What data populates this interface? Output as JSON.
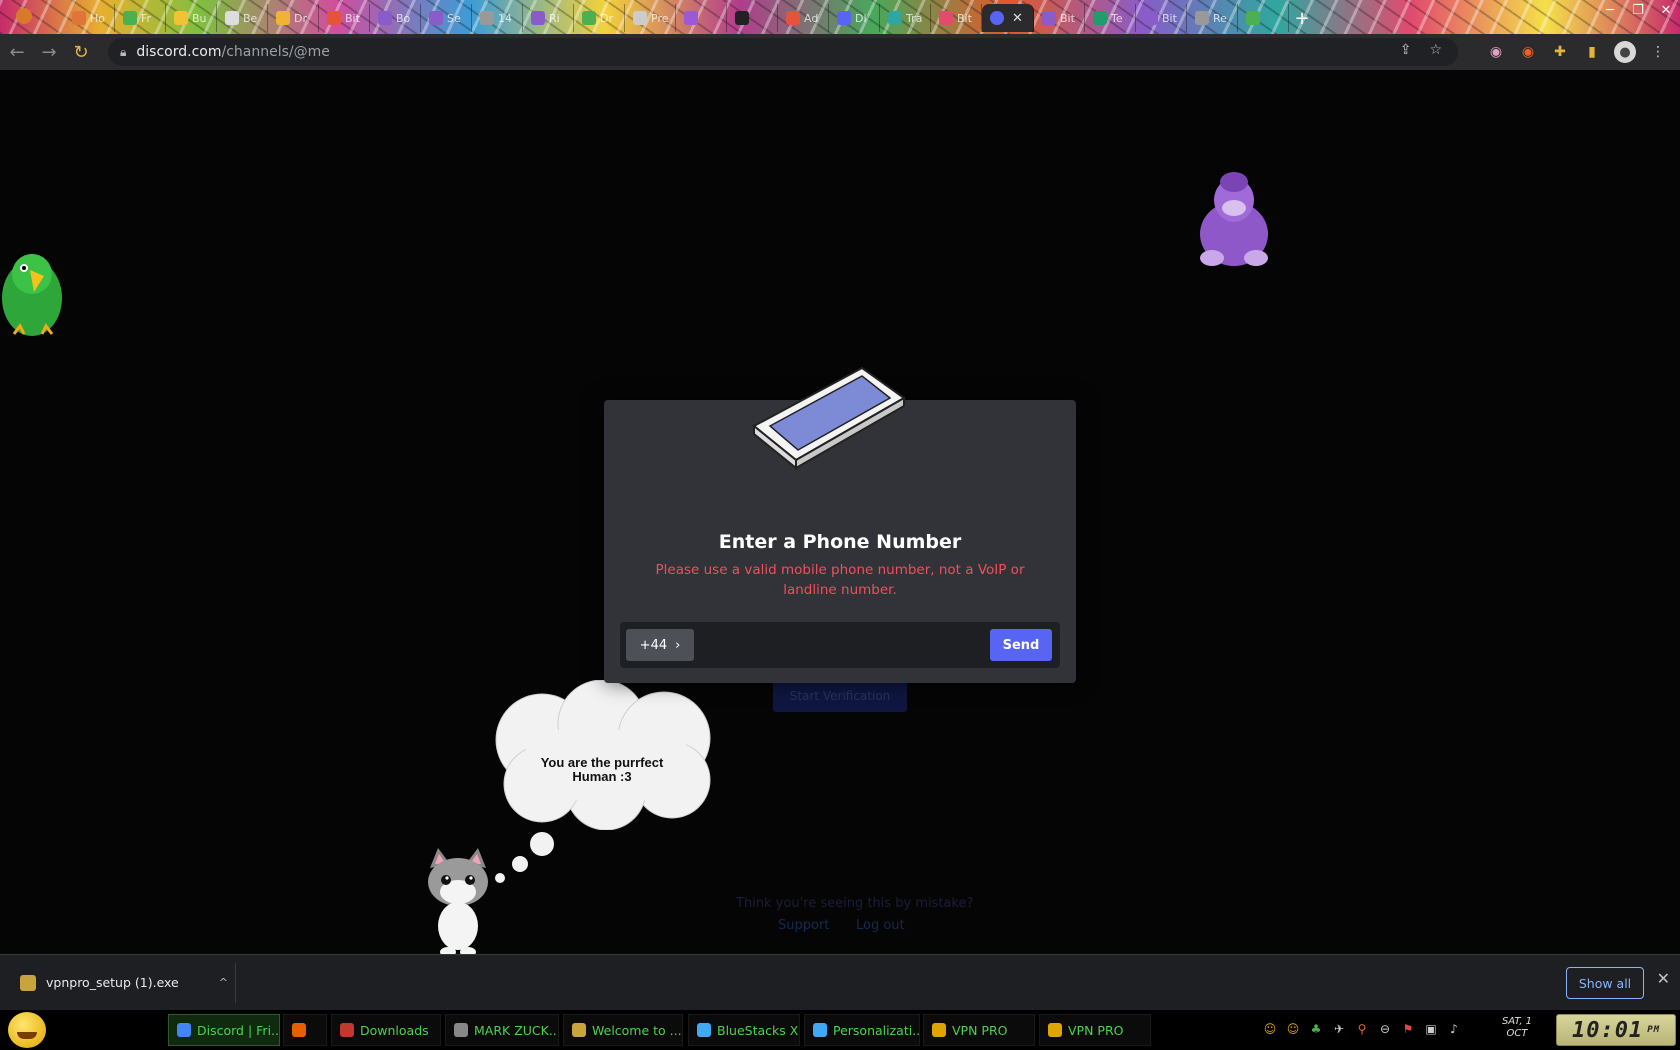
{
  "browser": {
    "tabs": [
      {
        "label": "Ho",
        "color": "#e0753a"
      },
      {
        "label": "Fr",
        "color": "#4caf50"
      },
      {
        "label": "Bu",
        "color": "#f1c232"
      },
      {
        "label": "Be",
        "color": "#dddddd"
      },
      {
        "label": "Dr",
        "color": "#f2b233"
      },
      {
        "label": "Bit",
        "color": "#e5533a"
      },
      {
        "label": "Bo",
        "color": "#8a5cc9"
      },
      {
        "label": "Se",
        "color": "#8a5cc9"
      },
      {
        "label": "14",
        "color": "#999999"
      },
      {
        "label": "Ri",
        "color": "#8a5cc9"
      },
      {
        "label": "Dr",
        "color": "#4caf50"
      },
      {
        "label": "Pre",
        "color": "#cccccc"
      },
      {
        "label": "",
        "color": "#9b59d6"
      },
      {
        "label": "",
        "color": "#222222"
      },
      {
        "label": "Ad",
        "color": "#e5533a"
      },
      {
        "label": "Dl",
        "color": "#5865f2"
      },
      {
        "label": "Tra",
        "color": "#2fa7a0"
      },
      {
        "label": "Bit",
        "color": "#e24a6e"
      },
      {
        "label": "Bit",
        "color": "#8a5cc9"
      },
      {
        "label": "Te",
        "color": "#1f9e6b"
      },
      {
        "label": "Bit",
        "color": "#8a5cc9"
      },
      {
        "label": "Re",
        "color": "#999999"
      },
      {
        "label": "",
        "color": "#4caf50"
      }
    ],
    "active_tab_close": "✕",
    "new_tab_symbol": "+",
    "url_host": "discord.com",
    "url_path": "/channels/@me"
  },
  "modal": {
    "title": "Enter a Phone Number",
    "error": "Please use a valid mobile phone number, not a VoIP or landline number.",
    "country_code": "+44",
    "country_chevron": "›",
    "phone_placeholder": "",
    "send_label": "Send"
  },
  "background": {
    "start_verification": "Start Verification",
    "mistake_text": "Think you're seeing this by mistake?",
    "support_link": "Support",
    "logout_link": "Log out"
  },
  "cloud_text": "You are the purrfect Human :3",
  "download": {
    "filename": "vpnpro_setup (1).exe",
    "chevron": "^",
    "show_all": "Show all",
    "close": "✕"
  },
  "taskbar": {
    "items": [
      {
        "label": "Discord | Fri...",
        "color": "#4285f4",
        "active": true
      },
      {
        "label": "",
        "color": "#e66000",
        "active": false
      },
      {
        "label": "Downloads",
        "color": "#c0392b",
        "active": false
      },
      {
        "label": "MARK ZUCK...",
        "color": "#888888",
        "active": false
      },
      {
        "label": "Welcome to ...",
        "color": "#c9a33c",
        "active": false
      },
      {
        "label": "BlueStacks X",
        "color": "#3fa9f5",
        "active": false
      },
      {
        "label": "Personalizati...",
        "color": "#3fa9f5",
        "active": false
      },
      {
        "label": "VPN PRO",
        "color": "#e0a400",
        "active": false
      },
      {
        "label": "VPN PRO",
        "color": "#e0a400",
        "active": false
      }
    ],
    "date_day": "SAT, 1",
    "date_month": "OCT",
    "clock": "10:01",
    "clock_ampm": "PM"
  }
}
